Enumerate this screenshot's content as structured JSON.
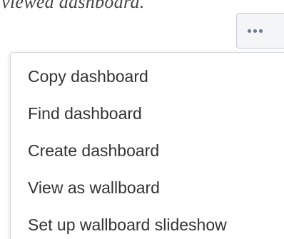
{
  "background": {
    "partial_text": "viewed dashboard."
  },
  "toolbar": {
    "more_button_icon": "more-horizontal-icon"
  },
  "menu": {
    "items": [
      {
        "label": "Copy dashboard"
      },
      {
        "label": "Find dashboard"
      },
      {
        "label": "Create dashboard"
      },
      {
        "label": "View as wallboard"
      },
      {
        "label": "Set up wallboard slideshow"
      }
    ]
  },
  "colors": {
    "button_bg": "#f4f5f7",
    "icon": "#6b778c",
    "text": "#333333",
    "menu_border": "#d6d9de"
  }
}
